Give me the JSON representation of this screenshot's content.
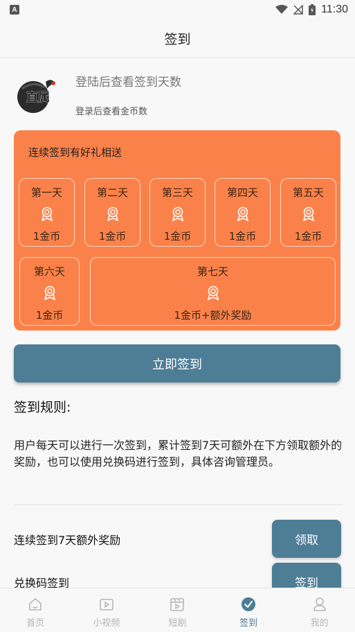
{
  "status_bar": {
    "time": "11:30",
    "notification_glyph": "A"
  },
  "title": "签到",
  "profile": {
    "login_prompt": "登陆后查看签到天数",
    "coins_prompt": "登录后查看金币数",
    "logo_text": "直属"
  },
  "reward_card": {
    "title": "连续签到有好礼相送",
    "color": "#fa824a",
    "days": [
      {
        "label": "第一天",
        "reward": "1金币"
      },
      {
        "label": "第二天",
        "reward": "1金币"
      },
      {
        "label": "第三天",
        "reward": "1金币"
      },
      {
        "label": "第四天",
        "reward": "1金币"
      },
      {
        "label": "第五天",
        "reward": "1金币"
      },
      {
        "label": "第六天",
        "reward": "1金币"
      },
      {
        "label": "第七天",
        "reward": "1金币+额外奖励"
      }
    ]
  },
  "signin_button": "立即签到",
  "rules": {
    "title": "签到规则:",
    "text": "用户每天可以进行一次签到，累计签到7天可额外在下方领取额外的奖励，也可以使用兑换码进行签到，具体咨询管理员。"
  },
  "bonus_row": {
    "label": "连续签到7天额外奖励",
    "button": "领取"
  },
  "redeem_row": {
    "label": "兑换码签到",
    "button": "签到"
  },
  "tabs": [
    {
      "label": "首页",
      "icon": "home-icon"
    },
    {
      "label": "小视频",
      "icon": "video-icon"
    },
    {
      "label": "短剧",
      "icon": "film-icon"
    },
    {
      "label": "签到",
      "icon": "check-circle-icon",
      "active": true
    },
    {
      "label": "我的",
      "icon": "user-icon"
    }
  ],
  "accent_color": "#4e7d96"
}
